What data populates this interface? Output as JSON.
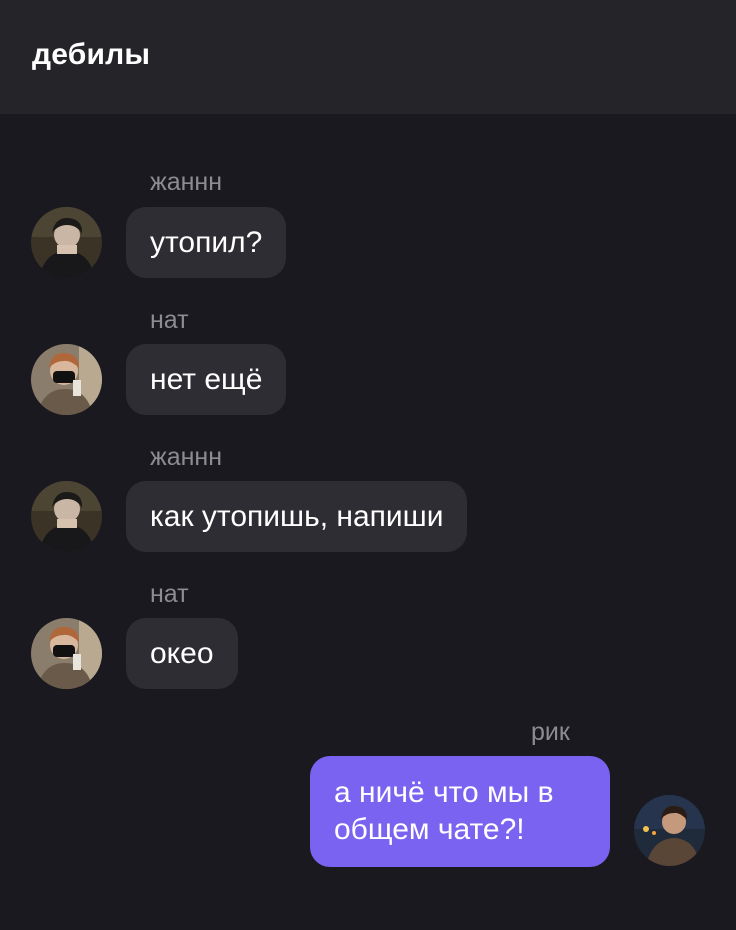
{
  "header": {
    "title": "дебилы"
  },
  "messages": [
    {
      "sender": "жаннн",
      "text": "утопил?",
      "avatar": "avatar-zhannn",
      "mine": false
    },
    {
      "sender": "нат",
      "text": "нет ещё",
      "avatar": "avatar-nat",
      "mine": false
    },
    {
      "sender": "жаннн",
      "text": "как утопишь, напиши",
      "avatar": "avatar-zhannn",
      "mine": false
    },
    {
      "sender": "нат",
      "text": "океo",
      "avatar": "avatar-nat",
      "mine": false
    },
    {
      "sender": "рик",
      "text": "а ничё что мы в общем чате?!",
      "avatar": "avatar-rik",
      "mine": true
    }
  ],
  "colors": {
    "background": "#1a191f",
    "header": "#252428",
    "bubble_incoming": "#2e2d33",
    "bubble_outgoing": "#7b63f2",
    "sender_name": "#8d8c93"
  }
}
